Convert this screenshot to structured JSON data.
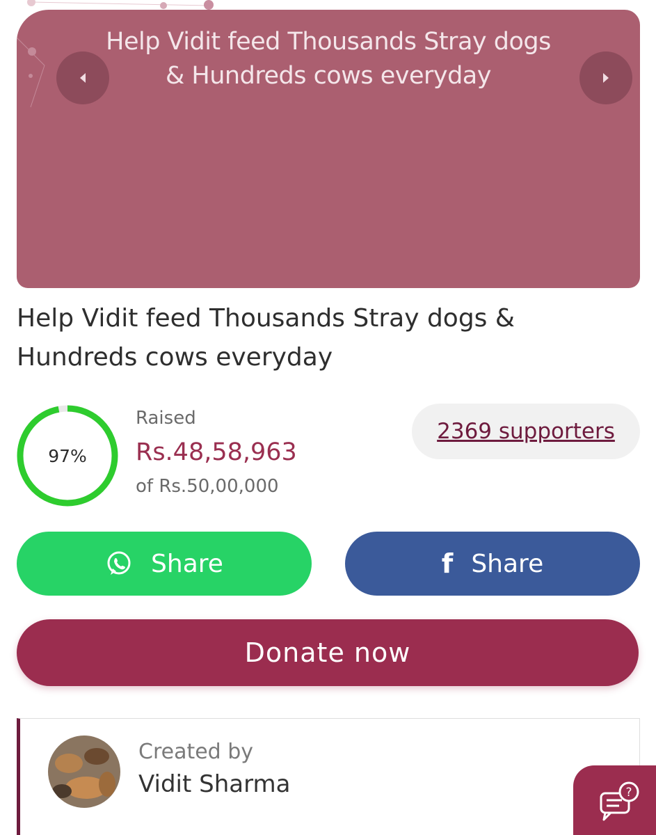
{
  "banner": {
    "title_line1": "Help Vidit feed Thousands Stray dogs",
    "title_line2": "&  Hundreds cows everyday",
    "prev_icon": "chevron-left-icon",
    "next_icon": "chevron-right-icon",
    "background": "#ab5f70"
  },
  "campaign": {
    "title": "Help Vidit feed Thousands Stray dogs & Hundreds cows everyday"
  },
  "progress": {
    "percent_label": "97%",
    "fraction": 0.97,
    "ring_color": "#2ecc2e"
  },
  "raised": {
    "label": "Raised",
    "amount": "Rs.48,58,963",
    "goal": "of Rs.50,00,000"
  },
  "supporters": {
    "label": "2369 supporters"
  },
  "share": {
    "whatsapp_label": "Share",
    "whatsapp_icon": "whatsapp-icon",
    "whatsapp_color": "#27d366",
    "facebook_label": "Share",
    "facebook_icon": "facebook-icon",
    "facebook_glyph": "f",
    "facebook_color": "#3b5a9a"
  },
  "donate": {
    "label": "Donate now",
    "color": "#9b2d4f"
  },
  "creator": {
    "created_by_label": "Created by",
    "name": "Vidit Sharma"
  },
  "help": {
    "icon": "help-chat-icon"
  }
}
